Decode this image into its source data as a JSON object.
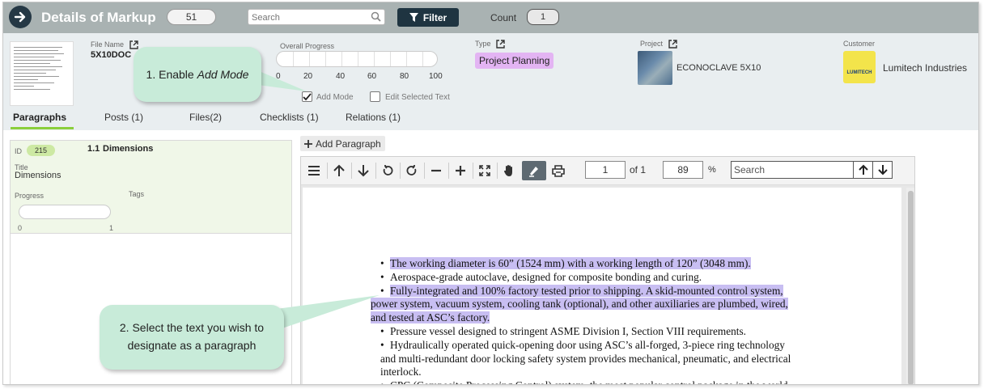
{
  "header": {
    "title": "Details of Markup",
    "count_pill": "51",
    "search_placeholder": "Search",
    "filter_label": "Filter",
    "count_label": "Count",
    "count_value": "1"
  },
  "info": {
    "file_name_label": "File Name",
    "file_name": "5X10DOC",
    "overall_progress_label": "Overall Progress",
    "progress_scale": [
      "0",
      "20",
      "40",
      "60",
      "80",
      "100"
    ],
    "add_mode_label": "Add Mode",
    "add_mode_checked": true,
    "edit_selected_label": "Edit Selected Text",
    "type_label": "Type",
    "type_value": "Project Planning",
    "type_color": "#e3b4f3",
    "project_label": "Project",
    "project_name": "ECONOCLAVE 5X10",
    "customer_label": "Customer",
    "customer_name": "Lumitech Industries",
    "customer_logo_text": "LUMITECH"
  },
  "tabs": [
    {
      "label": "Paragraphs",
      "active": true
    },
    {
      "label": "Posts (1)"
    },
    {
      "label": "Files(2)"
    },
    {
      "label": "Checklists (1)"
    },
    {
      "label": "Relations (1)"
    }
  ],
  "paragraph": {
    "id_label": "ID",
    "id_value": "215",
    "number": "1.1",
    "name": "Dimensions",
    "title_label": "Title",
    "title_value": "Dimensions",
    "progress_label": "Progress",
    "tags_label": "Tags",
    "progress_min": "0",
    "progress_max": "1"
  },
  "viewer": {
    "add_paragraph_label": "Add Paragraph",
    "page_value": "1",
    "of_label": "of 1",
    "zoom_value": "89",
    "percent_label": "%",
    "search_placeholder": "Search"
  },
  "document": {
    "lines": [
      {
        "text": "The working diameter is 60” (1524 mm) with a working length of 120” (3048 mm).",
        "bullet": true,
        "highlight": true
      },
      {
        "text": "Aerospace-grade autoclave, designed for composite bonding and curing.",
        "bullet": true,
        "highlight": false
      },
      {
        "text": "Fully-integrated and 100% factory tested prior to shipping. A skid-mounted control system,",
        "bullet": true,
        "highlight": true
      },
      {
        "text": "power system, vacuum system, cooling tank (optional), and other auxiliaries are plumbed, wired,",
        "bullet": false,
        "highlight": true
      },
      {
        "text": "and tested at ASC’s factory.",
        "bullet": false,
        "highlight": true
      },
      {
        "text": "Pressure vessel designed to stringent ASME Division I, Section VIII requirements.",
        "bullet": true,
        "highlight": false
      },
      {
        "text": "Hydraulically operated quick-opening door using ASC’s all-forged, 3-piece ring technology",
        "bullet": true,
        "highlight": false
      },
      {
        "text": "and multi-redundant door locking safety system provides mechanical, pneumatic, and electrical",
        "bullet": false,
        "highlight": false
      },
      {
        "text": "interlock.",
        "bullet": false,
        "highlight": false
      },
      {
        "text": "CPC (Composite Processing Control) system, the most popular control package in the world",
        "bullet": true,
        "highlight": false
      }
    ],
    "highlight_color": "#c8bef2"
  },
  "callouts": {
    "step1_prefix": "1. Enable ",
    "step1_emph": "Add Mode",
    "step2_line1": "2. Select the text you wish to",
    "step2_line2": "designate as a paragraph",
    "color": "#c8ebd9"
  }
}
